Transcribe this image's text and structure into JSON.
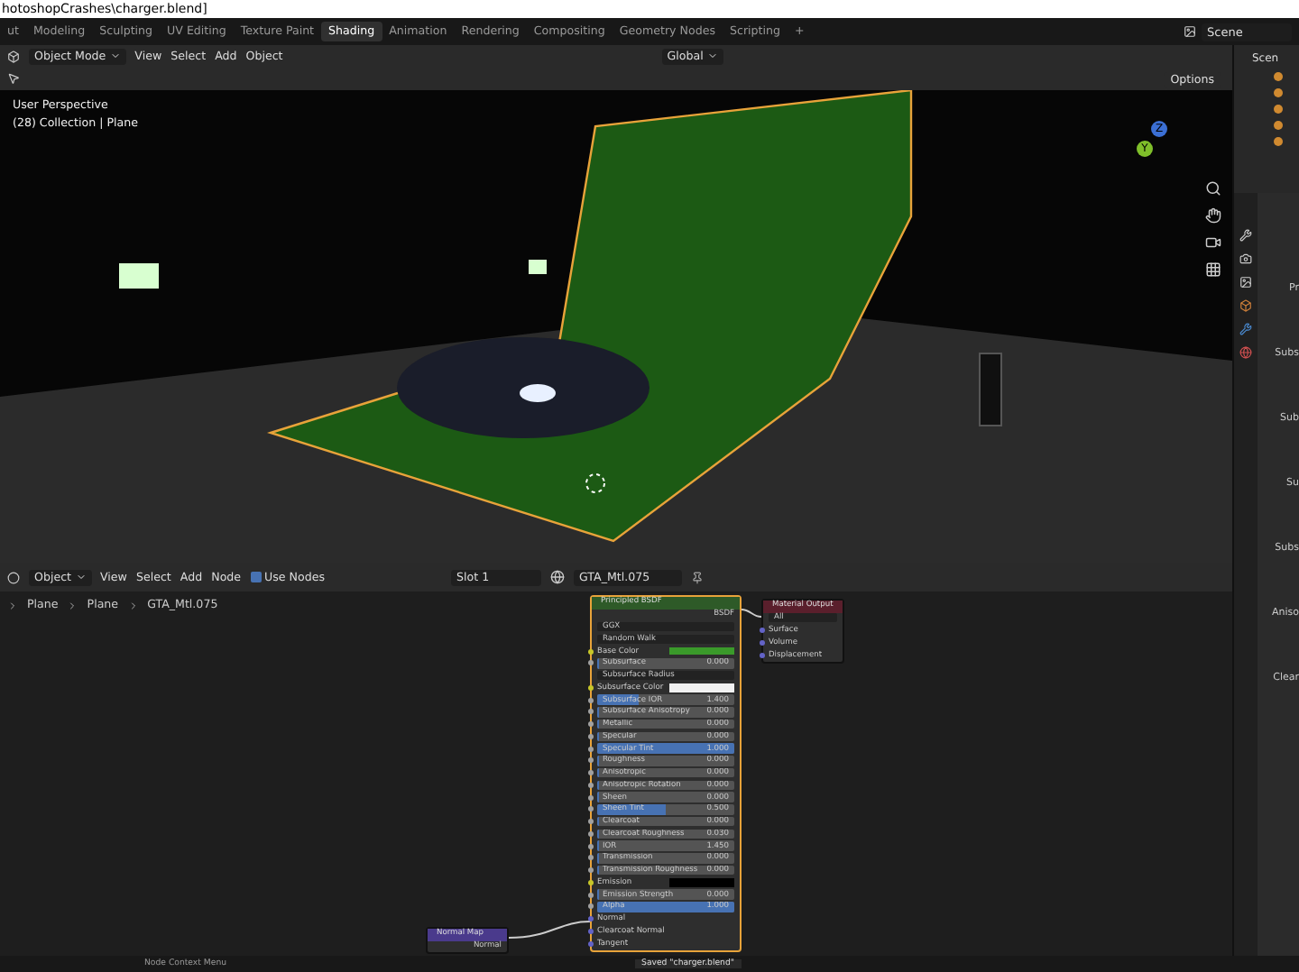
{
  "title_bar": {
    "title": "hotoshopCrashes\\charger.blend]"
  },
  "workspace_tabs": [
    {
      "label": "ut",
      "selected": false
    },
    {
      "label": "Modeling",
      "selected": false
    },
    {
      "label": "Sculpting",
      "selected": false
    },
    {
      "label": "UV Editing",
      "selected": false
    },
    {
      "label": "Texture Paint",
      "selected": false
    },
    {
      "label": "Shading",
      "selected": true
    },
    {
      "label": "Animation",
      "selected": false
    },
    {
      "label": "Rendering",
      "selected": false
    },
    {
      "label": "Compositing",
      "selected": false
    },
    {
      "label": "Geometry Nodes",
      "selected": false
    },
    {
      "label": "Scripting",
      "selected": false
    },
    {
      "label": "+",
      "selected": false
    }
  ],
  "scene_selector": {
    "value": "Scene"
  },
  "viewport": {
    "mode": "Object Mode",
    "menus": [
      "View",
      "Select",
      "Add",
      "Object"
    ],
    "orientation": "Global",
    "options": "Options",
    "overlay_text": [
      "User Perspective",
      "(28) Collection | Plane"
    ],
    "gizmo_axes": [
      "Z",
      "Y"
    ]
  },
  "node_editor": {
    "editor_type": "Object",
    "menus": [
      "View",
      "Select",
      "Add",
      "Node"
    ],
    "use_nodes": {
      "label": "Use Nodes",
      "checked": true
    },
    "slot": "Slot 1",
    "material": "GTA_Mtl.075",
    "breadcrumbs": [
      "Plane",
      "Plane",
      "GTA_Mtl.075"
    ],
    "nodes": [
      {
        "kind": "principled",
        "title": "Principled BSDF",
        "color": "#2e5a28",
        "rows": [
          {
            "kind": "output",
            "label": "BSDF"
          },
          {
            "kind": "dropdown",
            "label": "GGX"
          },
          {
            "kind": "dropdown",
            "label": "Random Walk"
          },
          {
            "kind": "color",
            "label": "Base Color",
            "color": "#3a9a2a"
          },
          {
            "kind": "slider",
            "label": "Subsurface",
            "value": "0.000",
            "level": 0
          },
          {
            "kind": "dropdown",
            "label": "Subsurface Radius"
          },
          {
            "kind": "color",
            "label": "Subsurface Color",
            "color": "#f2f2f2"
          },
          {
            "kind": "slider",
            "label": "Subsurface IOR",
            "value": "1.400",
            "level": 0.3
          },
          {
            "kind": "slider",
            "label": "Subsurface Anisotropy",
            "value": "0.000",
            "level": 0
          },
          {
            "kind": "slider",
            "label": "Metallic",
            "value": "0.000",
            "level": 0
          },
          {
            "kind": "slider",
            "label": "Specular",
            "value": "0.000",
            "level": 0
          },
          {
            "kind": "slider",
            "label": "Specular Tint",
            "value": "1.000",
            "level": 1
          },
          {
            "kind": "slider",
            "label": "Roughness",
            "value": "0.000",
            "level": 0
          },
          {
            "kind": "slider",
            "label": "Anisotropic",
            "value": "0.000",
            "level": 0
          },
          {
            "kind": "slider",
            "label": "Anisotropic Rotation",
            "value": "0.000",
            "level": 0
          },
          {
            "kind": "slider",
            "label": "Sheen",
            "value": "0.000",
            "level": 0
          },
          {
            "kind": "slider",
            "label": "Sheen Tint",
            "value": "0.500",
            "level": 0.5
          },
          {
            "kind": "slider",
            "label": "Clearcoat",
            "value": "0.000",
            "level": 0
          },
          {
            "kind": "slider",
            "label": "Clearcoat Roughness",
            "value": "0.030",
            "level": 0
          },
          {
            "kind": "slider",
            "label": "IOR",
            "value": "1.450",
            "level": 0
          },
          {
            "kind": "slider",
            "label": "Transmission",
            "value": "0.000",
            "level": 0
          },
          {
            "kind": "slider",
            "label": "Transmission Roughness",
            "value": "0.000",
            "level": 0
          },
          {
            "kind": "color",
            "label": "Emission",
            "color": "#000000"
          },
          {
            "kind": "slider",
            "label": "Emission Strength",
            "value": "0.000",
            "level": 0
          },
          {
            "kind": "slider",
            "label": "Alpha",
            "value": "1.000",
            "level": 1
          },
          {
            "kind": "socket",
            "label": "Normal"
          },
          {
            "kind": "socket",
            "label": "Clearcoat Normal"
          },
          {
            "kind": "socket",
            "label": "Tangent"
          }
        ]
      },
      {
        "kind": "output_node",
        "title": "Material Output",
        "color": "#5a1f2c",
        "rows": [
          {
            "kind": "dropdown",
            "label": "All"
          },
          {
            "kind": "socket",
            "label": "Surface"
          },
          {
            "kind": "socket",
            "label": "Volume"
          },
          {
            "kind": "socket",
            "label": "Displacement"
          }
        ]
      },
      {
        "kind": "normal_map",
        "title": "Normal Map",
        "color": "#4a3a8c",
        "rows": [
          {
            "kind": "output",
            "label": "Normal"
          }
        ]
      }
    ]
  },
  "properties_panel": {
    "outliner_header": "Scen",
    "labels": [
      "Pr",
      "Subs",
      "Sub",
      "Su",
      "Subs",
      "Aniso",
      "Clear"
    ]
  },
  "status_bar": {
    "hint": "Node Context Menu",
    "message": "Saved \"charger.blend\""
  }
}
